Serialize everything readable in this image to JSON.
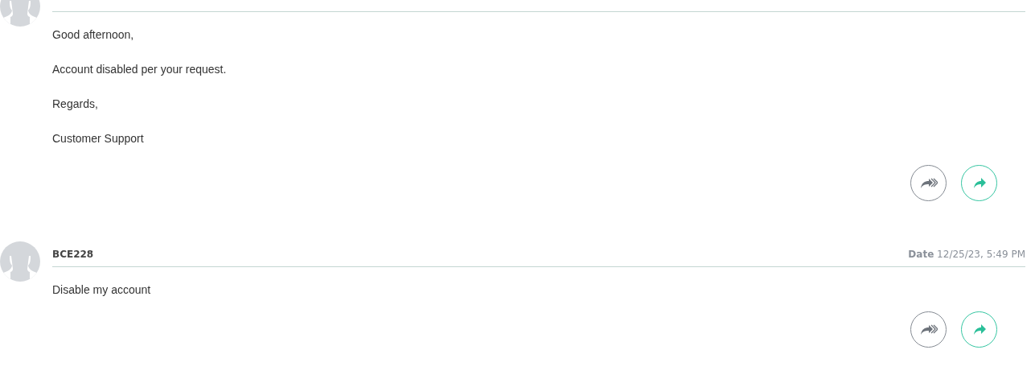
{
  "messages": [
    {
      "body": [
        "Good afternoon,",
        "Account disabled per your request.",
        "Regards,",
        "Customer Support"
      ]
    },
    {
      "sender": "BCE228",
      "date_label": "Date",
      "date": "12/25/23, 5:49 PM",
      "body": [
        "Disable my account"
      ]
    }
  ]
}
